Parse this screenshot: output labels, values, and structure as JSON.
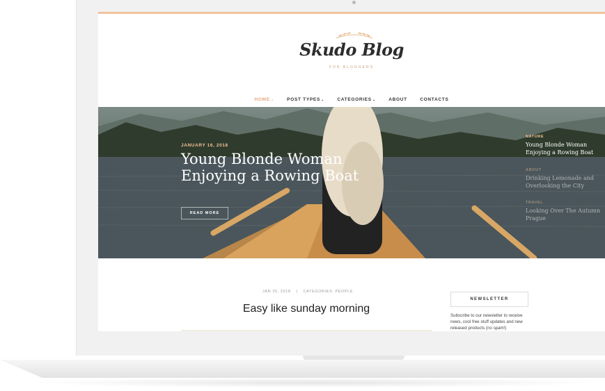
{
  "blog": {
    "logo": "Skudo Blog",
    "tagline": "FOR BLOGGERS"
  },
  "nav": {
    "items": [
      {
        "label": "HOME",
        "has_dropdown": true,
        "active": true
      },
      {
        "label": "POST TYPES",
        "has_dropdown": true,
        "active": false
      },
      {
        "label": "CATEGORIES",
        "has_dropdown": true,
        "active": false
      },
      {
        "label": "ABOUT",
        "has_dropdown": false,
        "active": false
      },
      {
        "label": "CONTACTS",
        "has_dropdown": false,
        "active": false
      }
    ],
    "caret": "⌄"
  },
  "hero": {
    "date": "JANUARY 16, 2018",
    "title": "Young Blonde Woman Enjoying a Rowing Boat",
    "read_more": "READ MORE",
    "side_posts": [
      {
        "category": "NATURE",
        "title": "Young Blonde Woman Enjoying a Rowing Boat"
      },
      {
        "category": "ABOUT",
        "title": "Drinking Lemonade and Overlooking the City"
      },
      {
        "category": "TRAVEL",
        "title": "Looking Over The Autumn Prague"
      }
    ]
  },
  "post": {
    "date": "JAN 25, 2018",
    "separator": "|",
    "categories": "CATEGORIES: PEOPLE",
    "title": "Easy like sunday morning"
  },
  "sidebar": {
    "newsletter_title": "NEWSLETTER",
    "newsletter_text": "Subscribe to our newsletter to receive news, cool free stuff updates and new released products (no spam!)"
  },
  "colors": {
    "accent": "#f0c39b",
    "active_nav": "#e8a57a",
    "text_dark": "#222222"
  }
}
